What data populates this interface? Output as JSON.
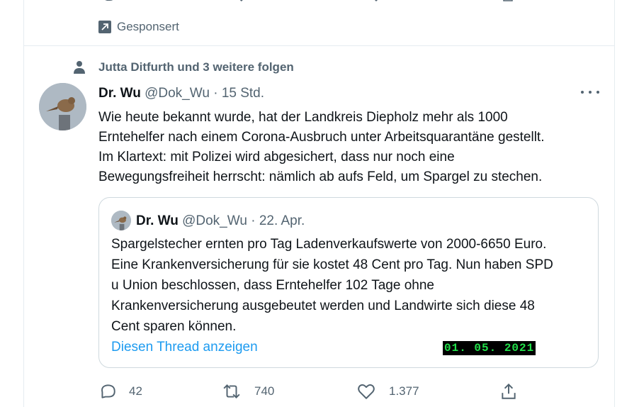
{
  "previous_tweet": {
    "promoted_label": "Gesponsert"
  },
  "social_context": {
    "text": "Jutta Ditfurth und 3 weitere folgen"
  },
  "tweet": {
    "author_name": "Dr. Wu",
    "handle": "@Dok_Wu",
    "separator": "·",
    "time": "15 Std.",
    "lines": [
      "Wie heute bekannt wurde, hat der Landkreis Diepholz mehr als 1000",
      "Erntehelfer nach einem Corona-Ausbruch unter Arbeitsquarantäne gestellt.",
      "Im Klartext: mit Polizei wird abgesichert, dass nur noch eine",
      "Bewegungsfreiheit herrscht: nämlich ab aufs Feld, um Spargel zu stechen."
    ],
    "quoted": {
      "author_name": "Dr. Wu",
      "handle": "@Dok_Wu",
      "separator": "·",
      "date": "22. Apr.",
      "lines": [
        "Spargelstecher ernten pro Tag Ladenverkaufswerte von 2000-6650 Euro.",
        "Eine Krankenversicherung für sie kostet 48 Cent pro Tag. Nun haben SPD",
        "u Union beschlossen, dass Erntehelfer 102 Tage ohne",
        "Krankenversicherung ausgebeutet werden und Landwirte sich diese 48",
        "Cent sparen können."
      ],
      "thread_link": "Diesen Thread anzeigen",
      "date_overlay": "01. 05. 2021"
    },
    "actions": {
      "replies": "42",
      "retweets": "740",
      "likes": "1.377"
    }
  },
  "colors": {
    "text_primary": "#0f1419",
    "text_secondary": "#536471",
    "link": "#1d9bf0",
    "border": "#cfd9de",
    "overlay_bg": "#000000",
    "overlay_text": "#22e04a"
  },
  "icons": [
    "reply-icon",
    "retweet-icon",
    "like-icon",
    "share-icon",
    "promoted-icon",
    "person-icon",
    "more-icon"
  ]
}
